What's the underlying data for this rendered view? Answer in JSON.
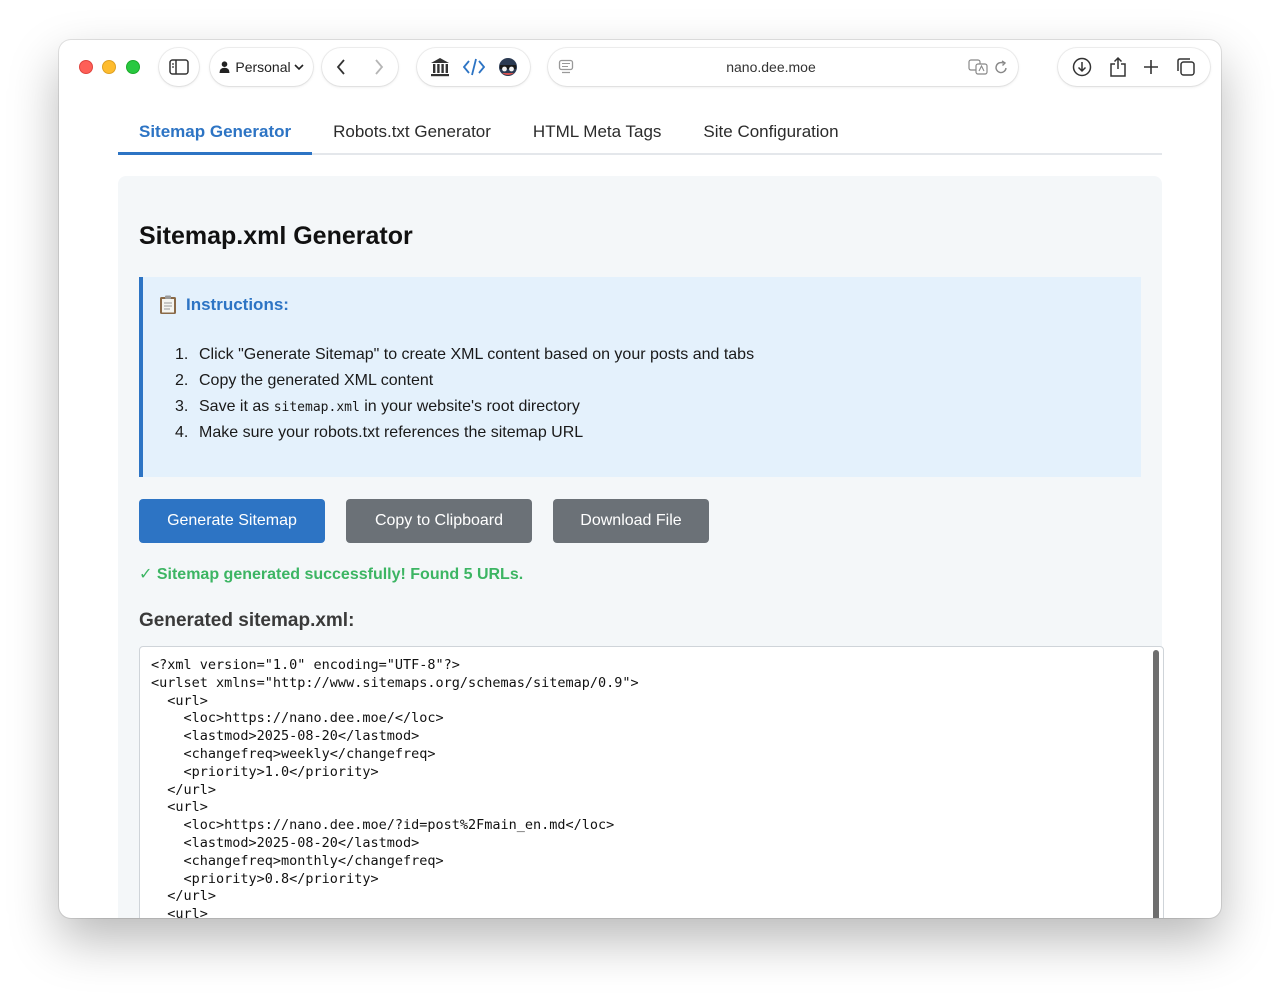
{
  "browser": {
    "profile_label": "Personal",
    "url": "nano.dee.moe"
  },
  "tabs": [
    {
      "label": "Sitemap Generator",
      "active": true
    },
    {
      "label": "Robots.txt Generator",
      "active": false
    },
    {
      "label": "HTML Meta Tags",
      "active": false
    },
    {
      "label": "Site Configuration",
      "active": false
    }
  ],
  "panel": {
    "title": "Sitemap.xml Generator",
    "instructions": {
      "heading": "Instructions:",
      "items": [
        {
          "num": "1.",
          "before": "Click \"Generate Sitemap\" to create XML content based on your posts and tabs",
          "code": "",
          "after": ""
        },
        {
          "num": "2.",
          "before": "Copy the generated XML content",
          "code": "",
          "after": ""
        },
        {
          "num": "3.",
          "before": "Save it as ",
          "code": "sitemap.xml",
          "after": " in your website's root directory"
        },
        {
          "num": "4.",
          "before": "Make sure your robots.txt references the sitemap URL",
          "code": "",
          "after": ""
        }
      ]
    },
    "buttons": {
      "generate": "Generate Sitemap",
      "copy": "Copy to Clipboard",
      "download": "Download File"
    },
    "success_message": "✓ Sitemap generated successfully! Found 5 URLs.",
    "output_label": "Generated sitemap.xml:",
    "xml_content": "<?xml version=\"1.0\" encoding=\"UTF-8\"?>\n<urlset xmlns=\"http://www.sitemaps.org/schemas/sitemap/0.9\">\n  <url>\n    <loc>https://nano.dee.moe/</loc>\n    <lastmod>2025-08-20</lastmod>\n    <changefreq>weekly</changefreq>\n    <priority>1.0</priority>\n  </url>\n  <url>\n    <loc>https://nano.dee.moe/?id=post%2Fmain_en.md</loc>\n    <lastmod>2025-08-20</lastmod>\n    <changefreq>monthly</changefreq>\n    <priority>0.8</priority>\n  </url>\n  <url>"
  },
  "colors": {
    "accent": "#2d74c4",
    "success": "#3cb563",
    "secondary_button": "#6b7177"
  }
}
